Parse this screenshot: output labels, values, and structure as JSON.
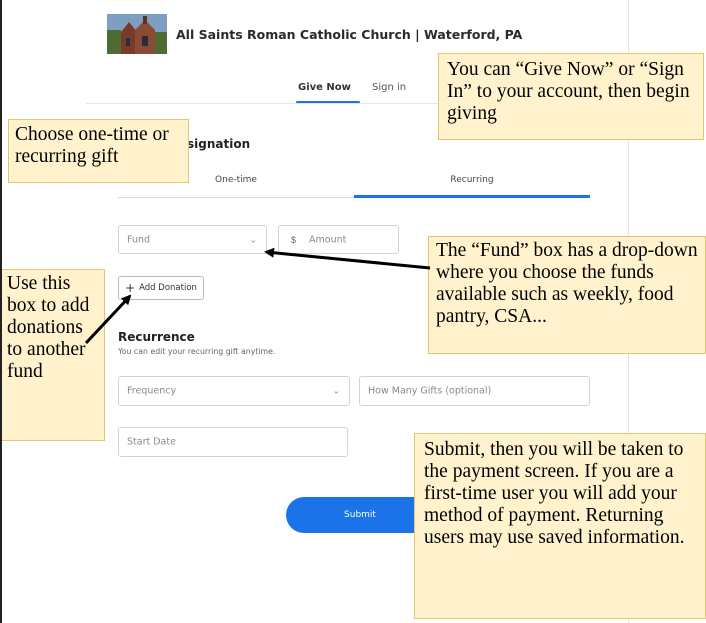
{
  "header": {
    "church_name": "All Saints Roman Catholic Church | Waterford, PA"
  },
  "nav": {
    "give_now": "Give Now",
    "sign_in": "Sign in"
  },
  "form": {
    "designation_title": "signation",
    "tabs": [
      {
        "label": "One-time",
        "active": false
      },
      {
        "label": "Recurring",
        "active": true
      }
    ],
    "fund_placeholder": "Fund",
    "currency_symbol": "$",
    "amount_placeholder": "Amount",
    "add_donation_label": "Add Donation",
    "recurrence_title": "Recurrence",
    "recurrence_subtitle": "You can edit your recurring gift anytime.",
    "frequency_placeholder": "Frequency",
    "how_many_placeholder": "How Many Gifts  (optional)",
    "start_date_placeholder": "Start Date",
    "submit_label": "Submit"
  },
  "callouts": {
    "give_now": "You can “Give Now” or “Sign In” to your account, then begin giving",
    "one_time": "Choose one-time or recurring gift",
    "fund": "The “Fund” box has a drop-down where you choose the funds available such as weekly, food pantry, CSA...",
    "add_donation": "Use this box to add donations to another fund",
    "submit": "Submit, then you will be taken to the payment screen. If you are a first-time user you will add your method of payment. Returning users may use saved information."
  },
  "colors": {
    "accent": "#1a73e8",
    "callout_fill": "#fff2cc",
    "callout_border": "#e0c770"
  }
}
